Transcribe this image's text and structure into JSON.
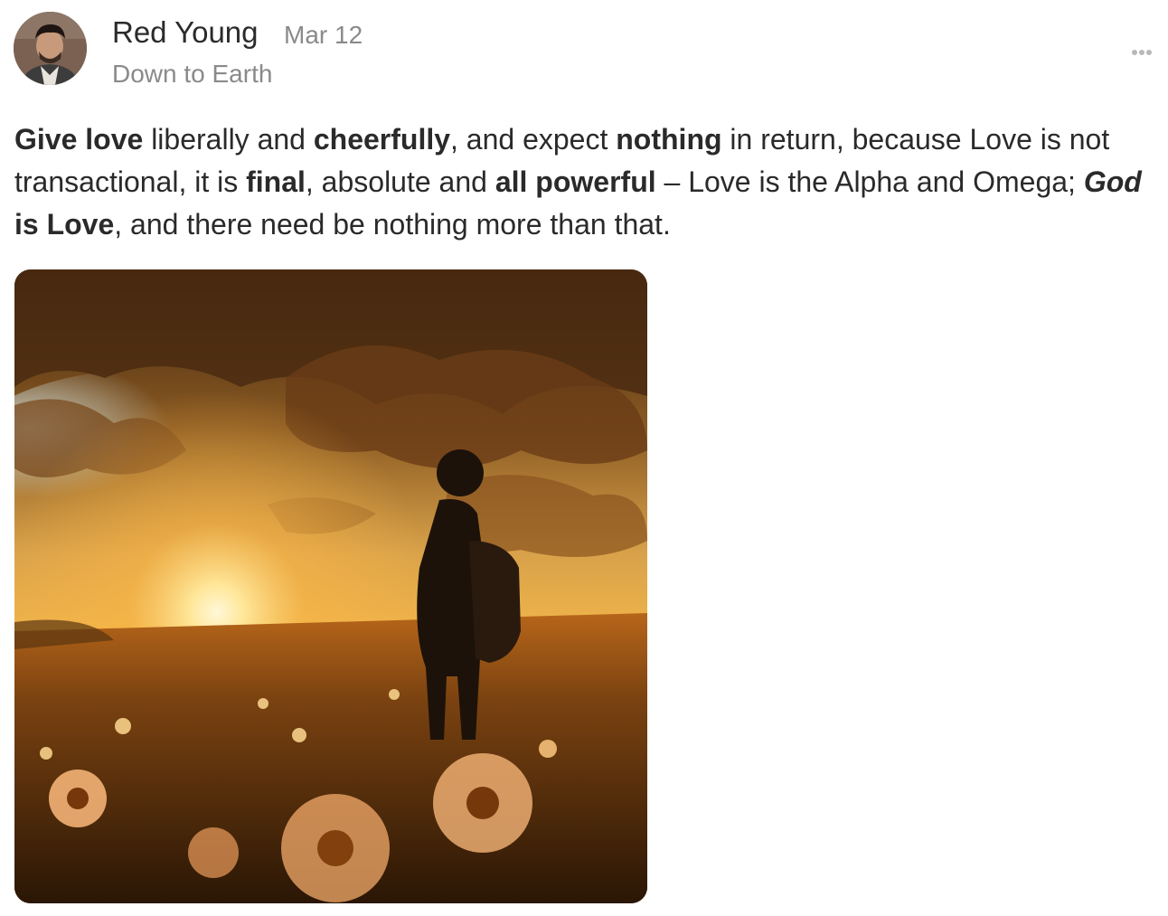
{
  "author": {
    "name": "Red Young",
    "avatar_icon": "person-avatar-icon"
  },
  "post": {
    "date": "Mar 12",
    "space": "Down to Earth",
    "more_icon": "ellipsis-icon",
    "body_segments": [
      {
        "text": "Give love",
        "style": "bold"
      },
      {
        "text": " liberally and ",
        "style": "normal"
      },
      {
        "text": "cheerfully",
        "style": "bold"
      },
      {
        "text": ", and expect ",
        "style": "normal"
      },
      {
        "text": "nothing",
        "style": "bold"
      },
      {
        "text": " in return, because Love is not transactional, it is ",
        "style": "normal"
      },
      {
        "text": "final",
        "style": "bold"
      },
      {
        "text": ", absolute and ",
        "style": "normal"
      },
      {
        "text": "all powerful",
        "style": "bold"
      },
      {
        "text": " – Love is the Alpha and Omega; ",
        "style": "normal"
      },
      {
        "text": "God",
        "style": "bold-italic"
      },
      {
        "text": " is Love",
        "style": "bold"
      },
      {
        "text": ", and there need be nothing more than that.",
        "style": "normal"
      }
    ],
    "image": {
      "subject": "silhouette-of-person-with-backpack-in-flower-field-at-sunset",
      "palette": {
        "sun": "#fff3c4",
        "sky": "#f2a63a",
        "cloud": "#6b3f17",
        "field": "#4a2a0c",
        "flower": "#f3b276"
      }
    }
  }
}
